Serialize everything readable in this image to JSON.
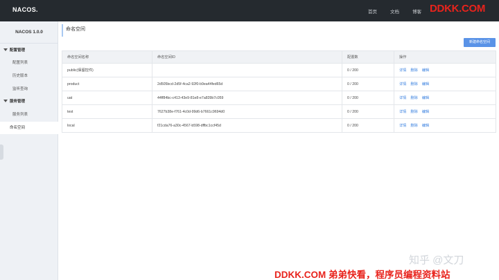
{
  "app": {
    "logo": "NACOS.",
    "version": "NACOS 1.0.0"
  },
  "topnav": [
    "首页",
    "文档",
    "博客"
  ],
  "watermarks": {
    "top": "DDKK.COM",
    "middle": "知乎 @文刀",
    "bottom": "DDKK.COM 弟弟快看，程序员编程资料站"
  },
  "sidebar": {
    "groups": [
      {
        "label": "配置管理",
        "items": [
          "配置列表",
          "历史版本",
          "监听查询"
        ]
      },
      {
        "label": "服务管理",
        "items": [
          "服务列表"
        ]
      }
    ],
    "active_item": "命名空间"
  },
  "page": {
    "title": "命名空间",
    "new_button": "新建命名空间"
  },
  "table": {
    "headers": [
      "命名空间名称",
      "命名空间ID",
      "配置数",
      "操作"
    ],
    "ops": [
      "详情",
      "删除",
      "编辑"
    ],
    "rows": [
      {
        "name": "public(保留控件)",
        "id": "",
        "count": "0 / 200"
      },
      {
        "name": "product",
        "id": "2d505bcd-2d5f-4ca2-92f0-b9ea44fed65d",
        "count": "0 / 200"
      },
      {
        "name": "uat",
        "id": "44ff84bc-c413-43e9-81e8-e7a839b7c059",
        "count": "0 / 200"
      },
      {
        "name": "test",
        "id": "7627b38e-f761-4c0d-99d6-b7661c9694d0",
        "count": "0 / 200"
      },
      {
        "name": "local",
        "id": "f21cda76-a30c-4567-b598-dffbc1ccf45d",
        "count": "0 / 200"
      }
    ]
  },
  "colors": {
    "topbar": "#252a2f",
    "sidebar": "#eef1f5",
    "accent": "#5a93e7",
    "link": "#3b82e0",
    "watermark_red": "#e8231c"
  }
}
